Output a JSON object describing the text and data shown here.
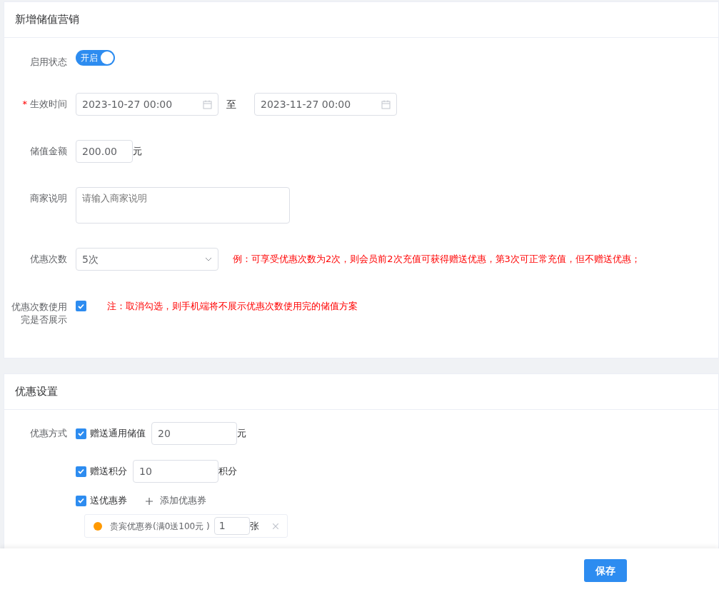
{
  "sections": [
    {
      "title": "新增储值营销",
      "fields": [
        {
          "kind": "switch",
          "label": "启用状态",
          "on": true,
          "text": "开启"
        },
        {
          "kind": "daterange",
          "label": "生效时间",
          "required_mark": "*",
          "start": "2023-10-27 00:00",
          "separator": "至",
          "end": "2023-11-27 00:00"
        },
        {
          "kind": "amount",
          "label": "储值金额",
          "value": "200.00",
          "unit": "元"
        },
        {
          "kind": "textarea",
          "label": "商家说明",
          "placeholder": "请输入商家说明"
        },
        {
          "kind": "select",
          "label": "优惠次数",
          "value": "5次",
          "note": "例：可享受优惠次数为2次，则会员前2次充值可获得赠送优惠，第3次可正常充值，但不赠送优惠；"
        },
        {
          "kind": "checkbox",
          "label": "优惠次数使用完是否展示",
          "checked": true,
          "note": "注：取消勾选，则手机端将不展示优惠次数使用完的储值方案"
        }
      ]
    },
    {
      "title": "优惠设置",
      "label": "优惠方式",
      "options": [
        {
          "kind": "input",
          "text": "赠送通用储值",
          "checked": true,
          "value": "20",
          "unit": "元"
        },
        {
          "kind": "input",
          "text": "赠送积分",
          "checked": true,
          "value": "10",
          "unit": "积分"
        },
        {
          "kind": "coupon",
          "text": "送优惠券",
          "checked": true,
          "add": "添加优惠券",
          "coupons": [
            {
              "name": "贵宾优惠券(满0送100元 )",
              "count": "1",
              "unit": "张"
            }
          ]
        }
      ]
    }
  ],
  "footer": {
    "save": "保存"
  }
}
